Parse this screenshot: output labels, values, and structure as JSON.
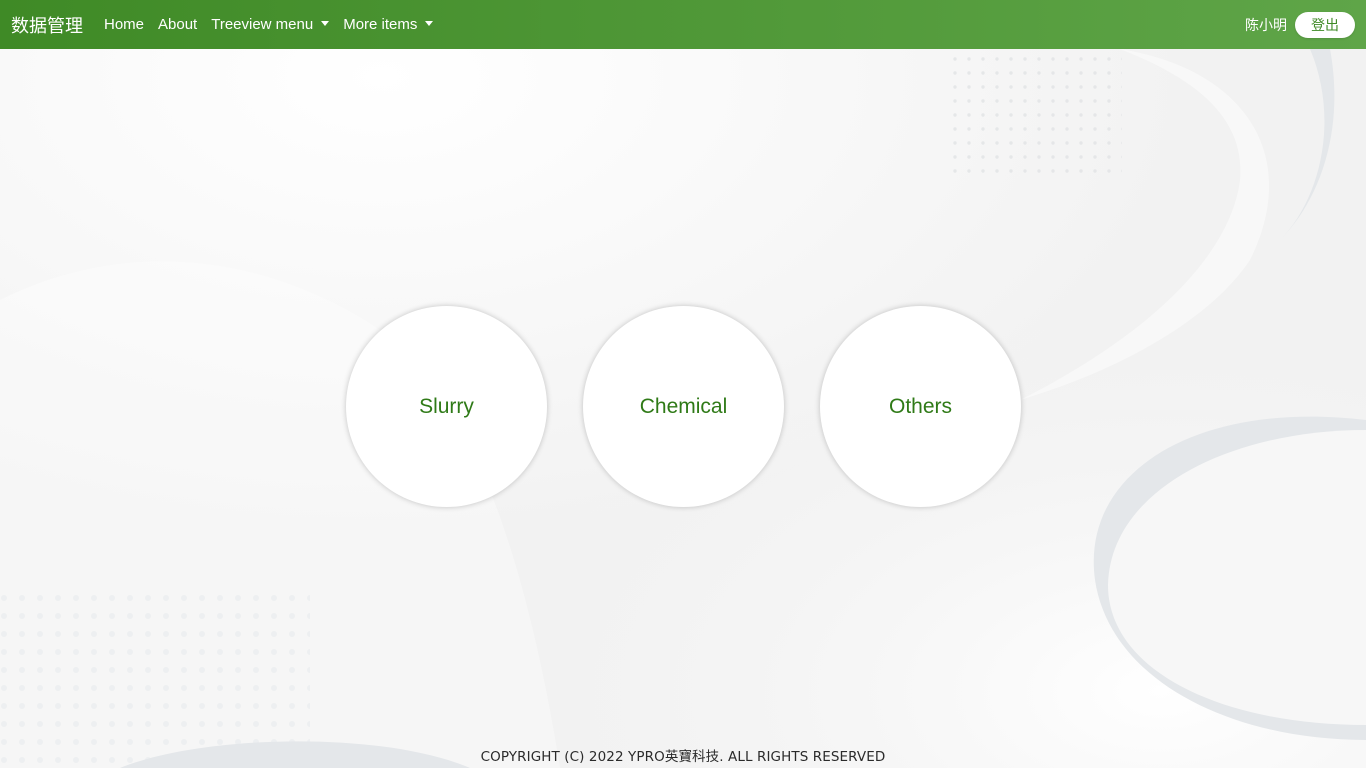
{
  "navbar": {
    "brand": "数据管理",
    "links": [
      {
        "label": "Home"
      },
      {
        "label": "About"
      },
      {
        "label": "Treeview menu",
        "dropdown": true
      },
      {
        "label": "More items",
        "dropdown": true
      }
    ],
    "user_name": "陈小明",
    "logout_label": "登出"
  },
  "categories": [
    {
      "label": "Slurry"
    },
    {
      "label": "Chemical"
    },
    {
      "label": "Others"
    }
  ],
  "footer": {
    "copyright": "COPYRIGHT (C) 2022 YPRO英寶科技. ALL RIGHTS RESERVED"
  },
  "colors": {
    "navbar_start": "#3f8a26",
    "navbar_end": "#5fa548",
    "accent_text": "#2f7a17",
    "background": "#f2f2f2"
  }
}
